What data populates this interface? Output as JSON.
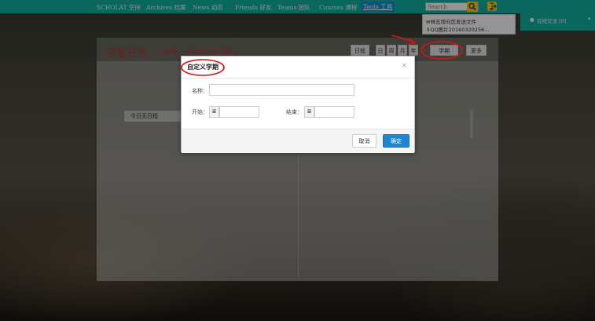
{
  "nav": {
    "items": [
      "SCHOLAT 空间",
      "Archives 档案",
      "News 动态",
      "Friends 好友",
      "Teams 团队",
      "Courses 课程",
      "Tools 工具"
    ],
    "active_index": 6,
    "search_placeholder": "Search",
    "bar_color": "#10b1a3",
    "active_color": "#1b8fd2"
  },
  "notifications": [
    "林志增向您发送文件",
    "QQ图片20160320256..."
  ],
  "chat": {
    "label": "在线交流 [0]"
  },
  "page": {
    "title": "学者日历",
    "subtitle": "今天是2016年4月20日 星期三",
    "view_buttons": [
      "日程",
      "日",
      "周",
      "月",
      "年"
    ],
    "subject_button": "学期",
    "more_button": "更多",
    "agenda_label": "今日无日程"
  },
  "dialog": {
    "title": "自定义学期",
    "close": "×",
    "name_label": "名称：",
    "start_label": "开始：",
    "end_label": "结束：",
    "cancel": "取消",
    "ok": "确定",
    "ok_color": "#1f86d1"
  },
  "icons": {
    "search": "search-icon",
    "logout": "logout-icon",
    "calendar": "calendar-icon",
    "close": "close-icon"
  }
}
